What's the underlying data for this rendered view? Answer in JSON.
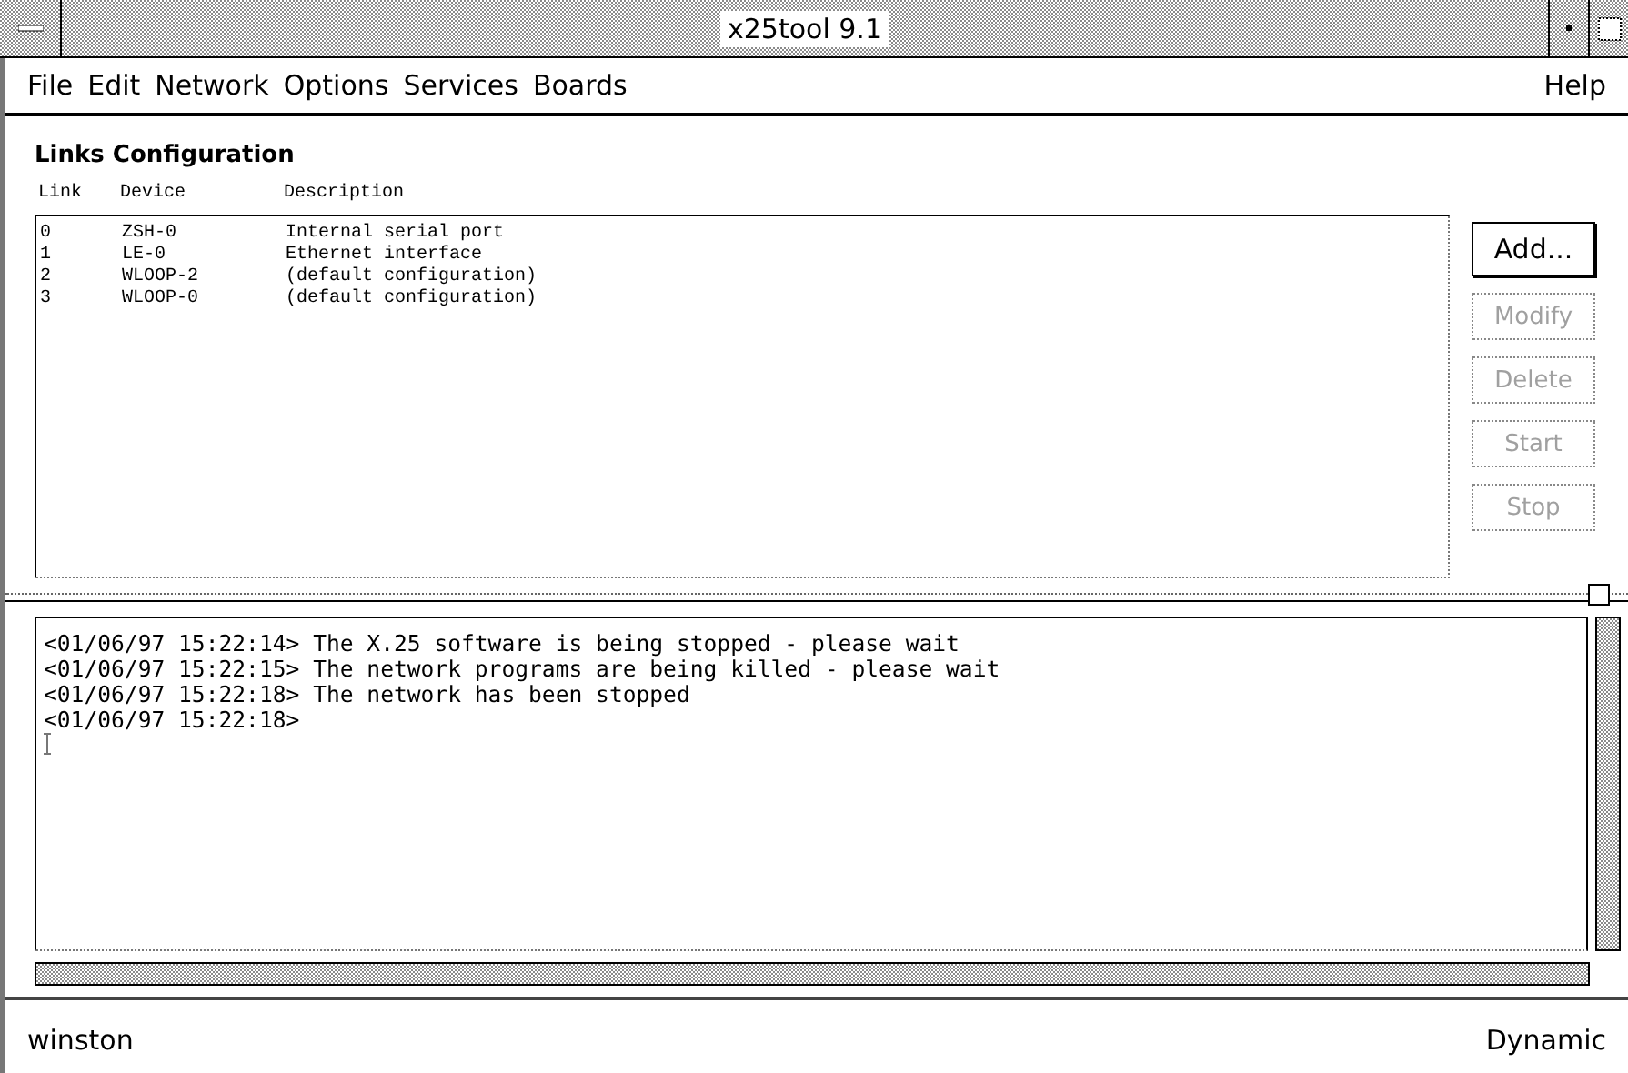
{
  "window": {
    "title": "x25tool 9.1"
  },
  "menu": {
    "items": [
      "File",
      "Edit",
      "Network",
      "Options",
      "Services",
      "Boards"
    ],
    "help": "Help"
  },
  "links": {
    "title": "Links Configuration",
    "columns": [
      "Link",
      "Device",
      "Description"
    ],
    "rows": [
      {
        "link": "0",
        "device": "ZSH-0",
        "description": "Internal serial port"
      },
      {
        "link": "1",
        "device": "LE-0",
        "description": "Ethernet interface"
      },
      {
        "link": "2",
        "device": "WLOOP-2",
        "description": "(default configuration)"
      },
      {
        "link": "3",
        "device": "WLOOP-0",
        "description": "(default configuration)"
      }
    ]
  },
  "buttons": [
    {
      "label": "Add...",
      "disabled": false
    },
    {
      "label": "Modify",
      "disabled": true
    },
    {
      "label": "Delete",
      "disabled": true
    },
    {
      "label": "Start",
      "disabled": true
    },
    {
      "label": "Stop",
      "disabled": true
    }
  ],
  "log": {
    "lines": [
      "<01/06/97 15:22:14> The X.25 software is being stopped - please wait",
      "<01/06/97 15:22:15> The network programs are being killed - please wait",
      "<01/06/97 15:22:18> The network has been stopped",
      "<01/06/97 15:22:18>"
    ]
  },
  "status_bar": {
    "host": "winston",
    "mode": "Dynamic"
  }
}
